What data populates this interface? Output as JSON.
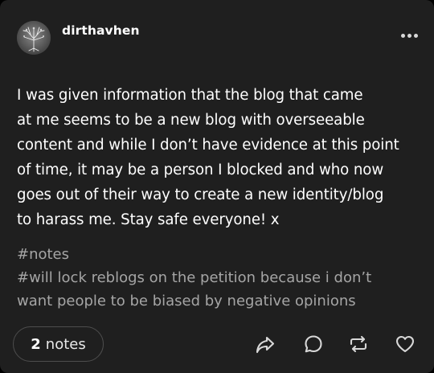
{
  "post": {
    "blog_name": "dirthavhen",
    "body_lines": [
      "I was given information that the blog that came",
      "at me seems to be a new blog with overseeable",
      "content and while I don’t have evidence at this point",
      "of time, it may be a person I blocked and who now",
      "goes out of their way to create a new identity/blog",
      "to harass me. Stay safe everyone! x"
    ],
    "tags": [
      "#notes",
      "#will lock reblogs on the petition because i don’t",
      "want people to be biased by negative opinions"
    ],
    "notes_count": "2",
    "notes_label": "notes"
  },
  "icons": {
    "avatar": "avatar-tree-image",
    "more": "more-dots-icon",
    "share": "share-arrow-icon",
    "reply": "reply-bubble-icon",
    "reblog": "reblog-icon",
    "like": "heart-icon"
  },
  "colors": {
    "card_background": "#1f1f1f",
    "text_primary": "#ffffff",
    "text_tags": "#a5a5a5",
    "icon": "#d8d8d8"
  }
}
